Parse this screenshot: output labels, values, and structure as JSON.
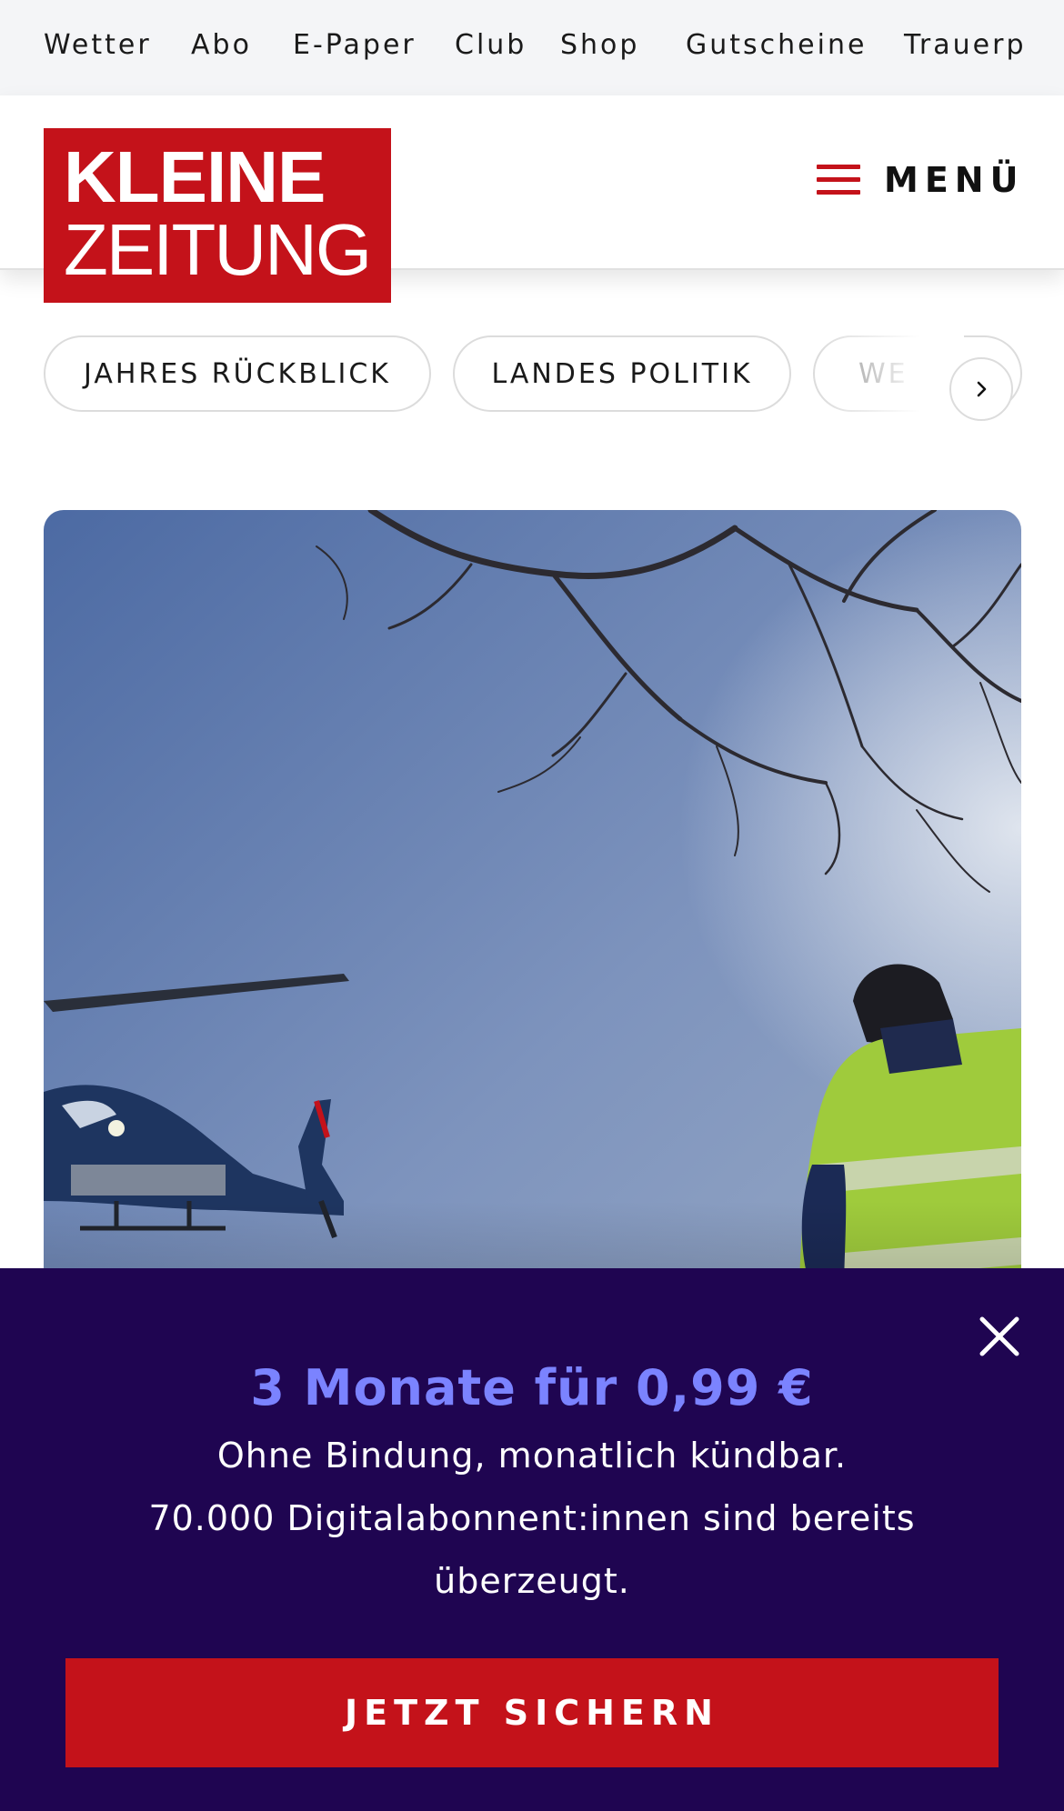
{
  "topnav": {
    "items": [
      "Wetter",
      "Abo",
      "E-Paper",
      "Club",
      "Shop",
      "Gutscheine",
      "Trauerp"
    ]
  },
  "header": {
    "logo": {
      "line1": "KLEINE",
      "line2": "ZEITUNG"
    },
    "menu_label": "MENÜ"
  },
  "categories": {
    "items": [
      "JAHRES RÜCKBLICK",
      "LANDES POLITIK",
      "WE"
    ]
  },
  "hero": {
    "icon": "photo-helicopter-rescue"
  },
  "promo": {
    "title": "3 Monate für 0,99 €",
    "line1": "Ohne Bindung, monatlich kündbar.",
    "line2": "70.000 Digitalabonnent:innen sind bereits überzeugt.",
    "cta": "JETZT SICHERN"
  },
  "colors": {
    "brand_red": "#c4121a",
    "promo_bg": "#1f0551",
    "promo_title": "#7b83ff",
    "topnav_bg": "#f4f5f7"
  }
}
